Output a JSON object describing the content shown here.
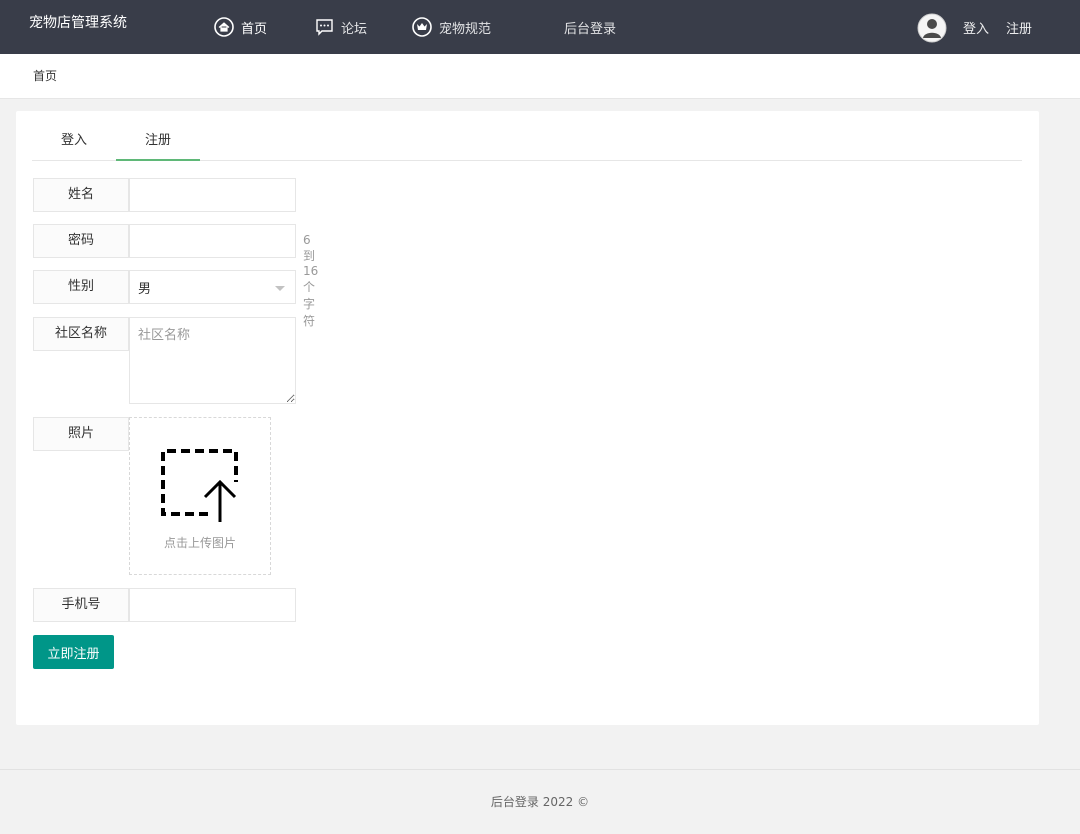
{
  "header": {
    "brand": "宠物店管理系统",
    "nav": [
      {
        "label": "首页",
        "icon": "home-icon"
      },
      {
        "label": "论坛",
        "icon": "chat-icon"
      },
      {
        "label": "宠物规范",
        "icon": "crown-icon"
      },
      {
        "label": "后台登录"
      }
    ],
    "login": "登入",
    "register": "注册"
  },
  "breadcrumb": "首页",
  "tabs": [
    "登入",
    "注册"
  ],
  "form": {
    "name_label": "姓名",
    "password_label": "密码",
    "password_hint": "6到16个字符",
    "gender_label": "性别",
    "gender_value": "男",
    "community_label": "社区名称",
    "community_placeholder": "社区名称",
    "photo_label": "照片",
    "upload_text": "点击上传图片",
    "phone_label": "手机号",
    "submit": "立即注册"
  },
  "footer": {
    "text": "后台登录  2022 ©"
  },
  "colors": {
    "header_bg": "#393d49",
    "accent": "#009688",
    "tab_underline": "#5fb878"
  }
}
